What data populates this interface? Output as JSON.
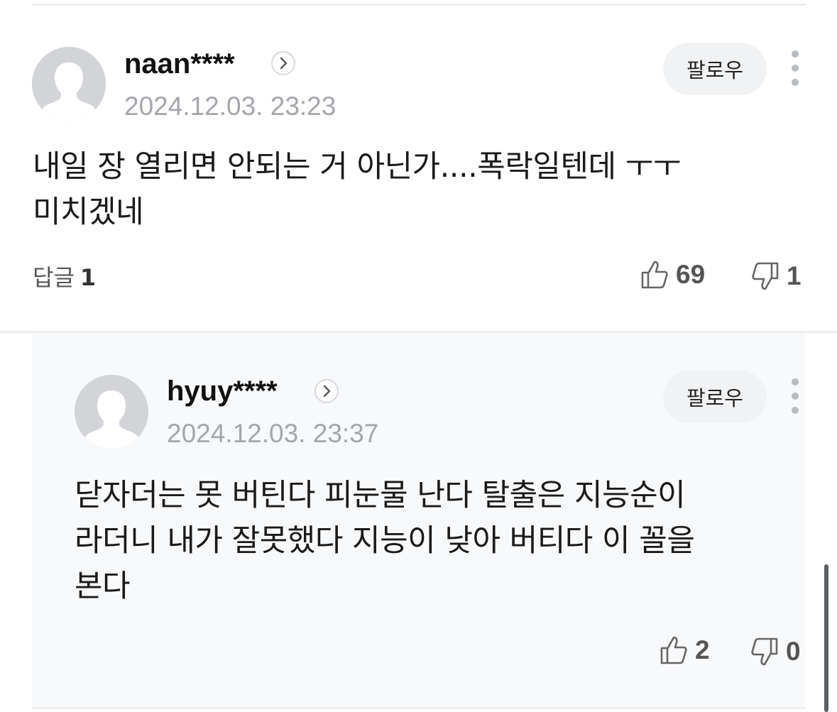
{
  "comments": [
    {
      "username": "naan****",
      "timestamp": "2024.12.03. 23:23",
      "follow_label": "팔로우",
      "text_line1": "내일 장 열리면 안되는 거 아닌가....폭락일텐데 ㅜㅜ",
      "text_line2": "미치겠네",
      "reply_label": "답글",
      "reply_count": "1",
      "likes": "69",
      "dislikes": "1"
    }
  ],
  "replies": [
    {
      "username": "hyuy****",
      "timestamp": "2024.12.03. 23:37",
      "follow_label": "팔로우",
      "text_line1": "닫자더는 못 버틴다 피눈물 난다 탈출은 지능순이",
      "text_line2": "라더니 내가 잘못했다 지능이 낮아 버티다 이 꼴을",
      "text_line3": "본다",
      "likes": "2",
      "dislikes": "0"
    }
  ],
  "icons": {
    "avatar": "default-avatar-icon",
    "profile_link": "chevron-right-icon",
    "more": "more-vertical-icon",
    "like": "thumbs-up-icon",
    "dislike": "thumbs-down-icon"
  },
  "colors": {
    "reply_background": "#f8f9fb",
    "timestamp": "#a3a6ab",
    "follow_button": "#f1f2f4"
  }
}
